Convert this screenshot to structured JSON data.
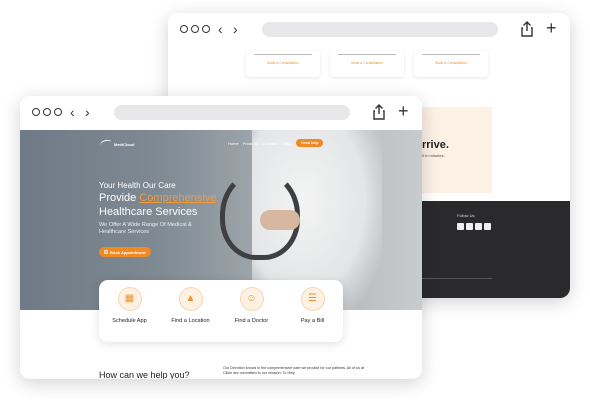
{
  "back_window": {
    "consult_labels": [
      "Book a Consultation",
      "Book a Consultation",
      "Book a Consultation"
    ],
    "banner_heading": "rrive.",
    "banner_sub": "0 in minutes.",
    "footer": {
      "follow_label": "Follow Us"
    }
  },
  "front_window": {
    "logo_text": "MediCloud",
    "nav": [
      "Home",
      "Products",
      "Contacts",
      "FAQs"
    ],
    "need_help": "Need help",
    "hero": {
      "line1": "Your Health Our Care",
      "line2_prefix": "Provide ",
      "line2_accent": "Comprehensive",
      "line3": "Healthcare Services",
      "subtitle": "We Offer A Wide Range Of Medical & Healthcare Services",
      "book_button": "Book Appointment"
    },
    "services": [
      {
        "label": "Schedule App",
        "icon": "calendar-icon"
      },
      {
        "label": "Find a Location",
        "icon": "map-icon"
      },
      {
        "label": "Find a Doctor",
        "icon": "doctor-icon"
      },
      {
        "label": "Pay a Bill",
        "icon": "bill-icon"
      }
    ],
    "help_title": "How can we help you?",
    "help_paragraph": "Our Devotion shows in the comprehensive care we provide for our patients. All of us at Cliluh are committed to our mission: To Help"
  },
  "colors": {
    "accent": "#f08a24",
    "footer_dark": "#2a2a2c",
    "peach": "#fdf1e6"
  }
}
